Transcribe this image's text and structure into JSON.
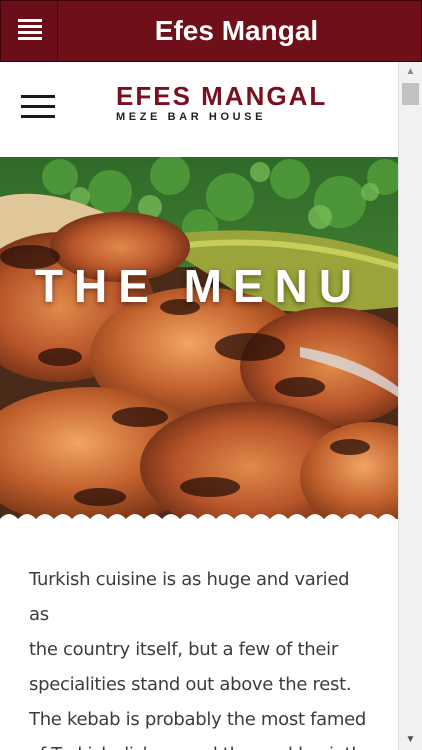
{
  "app": {
    "title": "Efes Mangal",
    "menu_icon": "menu-icon",
    "bar_color": "#6e0f1a"
  },
  "site": {
    "logo": {
      "main": "EFES MANGAL",
      "sub": "MEZE BAR HOUSE",
      "color": "#7a0f1f"
    },
    "nav_icon": "hamburger-icon"
  },
  "hero": {
    "title": "THE MENU"
  },
  "content": {
    "lines": [
      "Turkish cuisine is as huge and varied as",
      "the country itself, but a few of their",
      "specialities stand out above the rest.",
      "The kebab is probably the most famed",
      "of Turkish dishes, and the ocakbasi, the"
    ]
  },
  "scrollbar": {
    "up_icon": "scroll-up-arrow-icon",
    "down_icon": "scroll-down-arrow-icon",
    "up_glyph": "▲",
    "down_glyph": "▼"
  }
}
